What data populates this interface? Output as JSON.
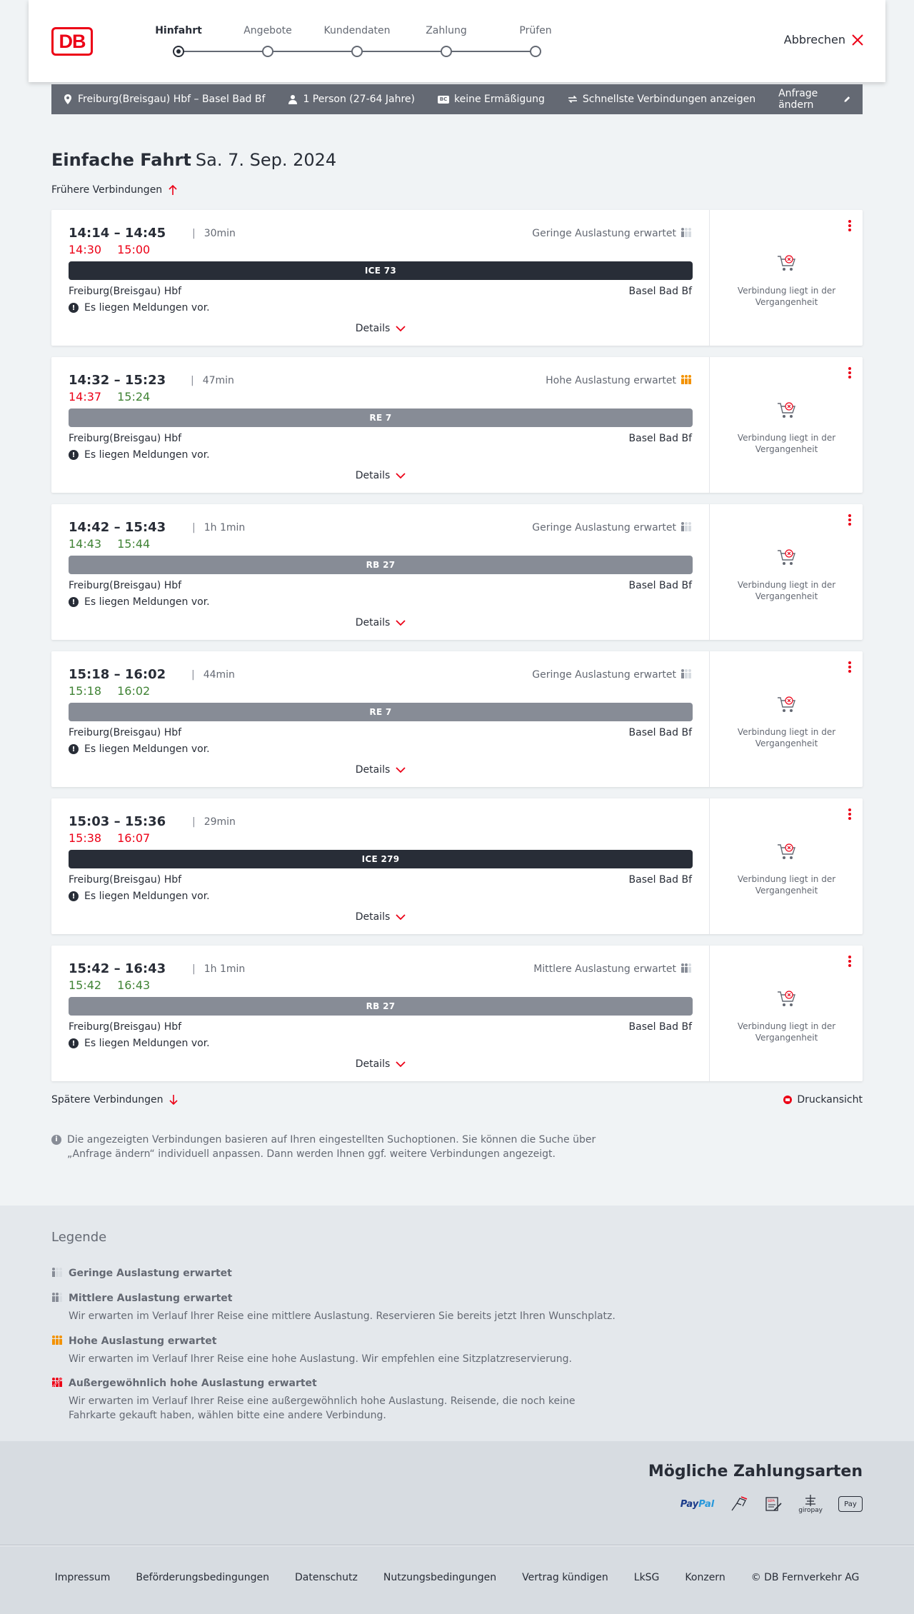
{
  "header": {
    "logo": "DB",
    "steps": [
      {
        "label": "Hinfahrt",
        "active": true
      },
      {
        "label": "Angebote",
        "active": false
      },
      {
        "label": "Kundendaten",
        "active": false
      },
      {
        "label": "Zahlung",
        "active": false
      },
      {
        "label": "Prüfen",
        "active": false
      }
    ],
    "cancel_label": "Abbrechen"
  },
  "search": {
    "route": "Freiburg(Breisgau) Hbf – Basel Bad Bf",
    "travellers": "1 Person (27-64 Jahre)",
    "discount_badge": "BC",
    "discount": "keine Ermäßigung",
    "fastest": "Schnellste Verbindungen anzeigen",
    "edit_label": "Anfrage ändern"
  },
  "page": {
    "title": "Einfache Fahrt",
    "date": "Sa. 7. Sep. 2024",
    "earlier_label": "Frühere Verbindungen",
    "later_label": "Spätere Verbindungen",
    "print_label": "Druckansicht",
    "info_text": "Die angezeigten Verbindungen basieren auf Ihren eingestellten Suchoptionen. Sie können die Suche über „Anfrage ändern“ individuell anpassen. Dann werden Ihnen ggf. weitere Verbindungen angezeigt."
  },
  "connections": [
    {
      "times": "14:14 – 14:45",
      "duration": "30min",
      "rt_dep": "14:30",
      "rt_arr": "15:00",
      "rt_dep_status": "late",
      "rt_arr_status": "late",
      "load": "Geringe Auslastung erwartet",
      "load_level": "low",
      "train": "ICE 73",
      "train_style": "dark",
      "from": "Freiburg(Breisgau) Hbf",
      "to": "Basel Bad Bf",
      "message": "Es liegen Meldungen vor.",
      "details": "Details",
      "status": "Verbindung liegt in der Vergangenheit"
    },
    {
      "times": "14:32 – 15:23",
      "duration": "47min",
      "rt_dep": "14:37",
      "rt_arr": "15:24",
      "rt_dep_status": "late",
      "rt_arr_status": "ontime",
      "load": "Hohe Auslastung erwartet",
      "load_level": "high",
      "train": "RE 7",
      "train_style": "grey",
      "from": "Freiburg(Breisgau) Hbf",
      "to": "Basel Bad Bf",
      "message": "Es liegen Meldungen vor.",
      "details": "Details",
      "status": "Verbindung liegt in der Vergangenheit"
    },
    {
      "times": "14:42 – 15:43",
      "duration": "1h 1min",
      "rt_dep": "14:43",
      "rt_arr": "15:44",
      "rt_dep_status": "ontime",
      "rt_arr_status": "ontime",
      "load": "Geringe Auslastung erwartet",
      "load_level": "low",
      "train": "RB 27",
      "train_style": "grey",
      "from": "Freiburg(Breisgau) Hbf",
      "to": "Basel Bad Bf",
      "message": "Es liegen Meldungen vor.",
      "details": "Details",
      "status": "Verbindung liegt in der Vergangenheit"
    },
    {
      "times": "15:18 – 16:02",
      "duration": "44min",
      "rt_dep": "15:18",
      "rt_arr": "16:02",
      "rt_dep_status": "ontime",
      "rt_arr_status": "ontime",
      "load": "Geringe Auslastung erwartet",
      "load_level": "low",
      "train": "RE 7",
      "train_style": "grey",
      "from": "Freiburg(Breisgau) Hbf",
      "to": "Basel Bad Bf",
      "message": "Es liegen Meldungen vor.",
      "details": "Details",
      "status": "Verbindung liegt in der Vergangenheit"
    },
    {
      "times": "15:03 – 15:36",
      "duration": "29min",
      "rt_dep": "15:38",
      "rt_arr": "16:07",
      "rt_dep_status": "late",
      "rt_arr_status": "late",
      "load": "",
      "load_level": "none",
      "train": "ICE 279",
      "train_style": "dark",
      "from": "Freiburg(Breisgau) Hbf",
      "to": "Basel Bad Bf",
      "message": "Es liegen Meldungen vor.",
      "details": "Details",
      "status": "Verbindung liegt in der Vergangenheit"
    },
    {
      "times": "15:42 – 16:43",
      "duration": "1h 1min",
      "rt_dep": "15:42",
      "rt_arr": "16:43",
      "rt_dep_status": "ontime",
      "rt_arr_status": "ontime",
      "load": "Mittlere Auslastung erwartet",
      "load_level": "medium",
      "train": "RB 27",
      "train_style": "grey",
      "from": "Freiburg(Breisgau) Hbf",
      "to": "Basel Bad Bf",
      "message": "Es liegen Meldungen vor.",
      "details": "Details",
      "status": "Verbindung liegt in der Vergangenheit"
    }
  ],
  "legend": {
    "title": "Legende",
    "items": [
      {
        "level": "low",
        "title": "Geringe Auslastung erwartet",
        "desc": ""
      },
      {
        "level": "medium",
        "title": "Mittlere Auslastung erwartet",
        "desc": "Wir erwarten im Verlauf Ihrer Reise eine mittlere Auslastung. Reservieren Sie bereits jetzt Ihren Wunschplatz."
      },
      {
        "level": "high",
        "title": "Hohe Auslastung erwartet",
        "desc": "Wir erwarten im Verlauf Ihrer Reise eine hohe Auslastung. Wir empfehlen eine Sitzplatzreservierung."
      },
      {
        "level": "extreme",
        "title": "Außergewöhnlich hohe Auslastung erwartet",
        "desc": "Wir erwarten im Verlauf Ihrer Reise eine außergewöhnlich hohe Auslastung. Reisende, die noch keine Fahrkarte gekauft haben, wählen bitte eine andere Verbindung."
      }
    ]
  },
  "payment": {
    "title": "Mögliche Zahlungsarten",
    "paypal_1": "Pay",
    "paypal_2": "Pal",
    "giropay": "giropay",
    "sepa": "SEPA",
    "applepay": "Pay"
  },
  "footer": {
    "links": [
      "Impressum",
      "Beförderungsbedingungen",
      "Datenschutz",
      "Nutzungsbedingungen",
      "Vertrag kündigen",
      "LkSG",
      "Konzern",
      "© DB Fernverkehr AG"
    ]
  },
  "colors": {
    "brand_red": "#ec0016",
    "late": "#ec0016",
    "ontime": "#408335",
    "high_load": "#f39200",
    "dark": "#282d37",
    "grey": "#878c96"
  }
}
